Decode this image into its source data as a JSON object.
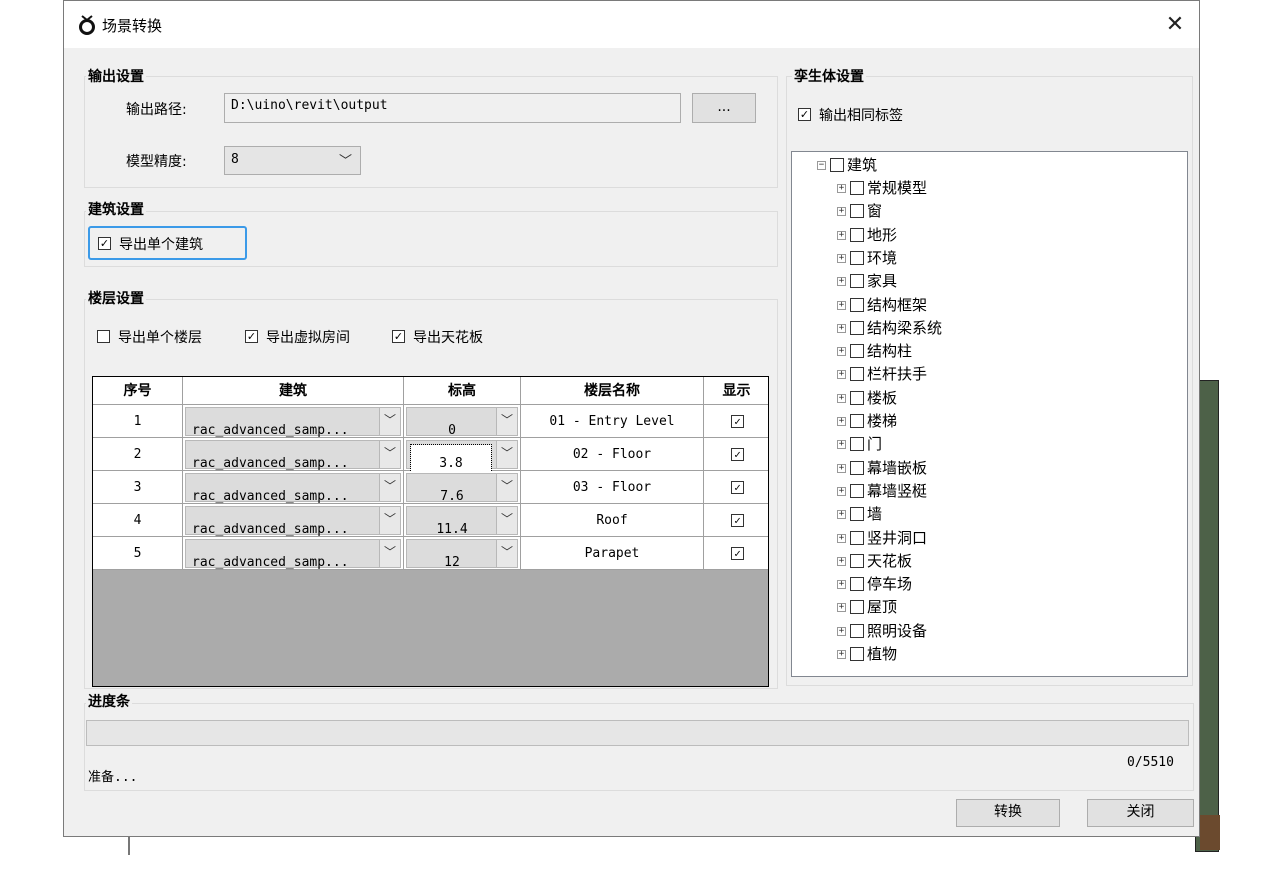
{
  "window": {
    "title": "场景转换",
    "close_glyph": "✕"
  },
  "output_settings": {
    "title": "输出设置",
    "path_label": "输出路径:",
    "path_value": "D:\\uino\\revit\\output",
    "browse_label": "...",
    "precision_label": "模型精度:",
    "precision_value": "8"
  },
  "building_settings": {
    "title": "建筑设置",
    "export_single_building": {
      "label": "导出单个建筑",
      "checked": true
    }
  },
  "floor_settings": {
    "title": "楼层设置",
    "options": [
      {
        "label": "导出单个楼层",
        "checked": false
      },
      {
        "label": "导出虚拟房间",
        "checked": true
      },
      {
        "label": "导出天花板",
        "checked": true
      }
    ]
  },
  "grid": {
    "headers": [
      "序号",
      "建筑",
      "标高",
      "楼层名称",
      "显示"
    ],
    "rows": [
      {
        "index": "1",
        "building": "rac_advanced_samp...",
        "level": "0",
        "name": "01 - Entry Level",
        "show": true
      },
      {
        "index": "2",
        "building": "rac_advanced_samp...",
        "level": "3.8",
        "name": "02 - Floor",
        "show": true
      },
      {
        "index": "3",
        "building": "rac_advanced_samp...",
        "level": "7.6",
        "name": "03 - Floor",
        "show": true
      },
      {
        "index": "4",
        "building": "rac_advanced_samp...",
        "level": "11.4",
        "name": "Roof",
        "show": true
      },
      {
        "index": "5",
        "building": "rac_advanced_samp...",
        "level": "12",
        "name": "Parapet",
        "show": true
      }
    ]
  },
  "twin_settings": {
    "title": "孪生体设置",
    "same_tag": {
      "label": "输出相同标签",
      "checked": true
    },
    "tree_root": "建筑",
    "tree_items": [
      "常规模型",
      "窗",
      "地形",
      "环境",
      "家具",
      "结构框架",
      "结构梁系统",
      "结构柱",
      "栏杆扶手",
      "楼板",
      "楼梯",
      "门",
      "幕墙嵌板",
      "幕墙竖梃",
      "墙",
      "竖井洞口",
      "天花板",
      "停车场",
      "屋顶",
      "照明设备",
      "植物"
    ]
  },
  "progress": {
    "title": "进度条",
    "status": "准备...",
    "count": "0/5510",
    "fraction": 0
  },
  "buttons": {
    "convert": "转换",
    "close": "关闭"
  },
  "icons": {
    "app": "app-logo-icon",
    "dropdown": "chevron-down-icon",
    "expand": "plus-box-icon",
    "collapse": "minus-box-icon"
  },
  "colors": {
    "focus": "#3b9ae8",
    "dialog_bg": "#f0f0f0"
  }
}
